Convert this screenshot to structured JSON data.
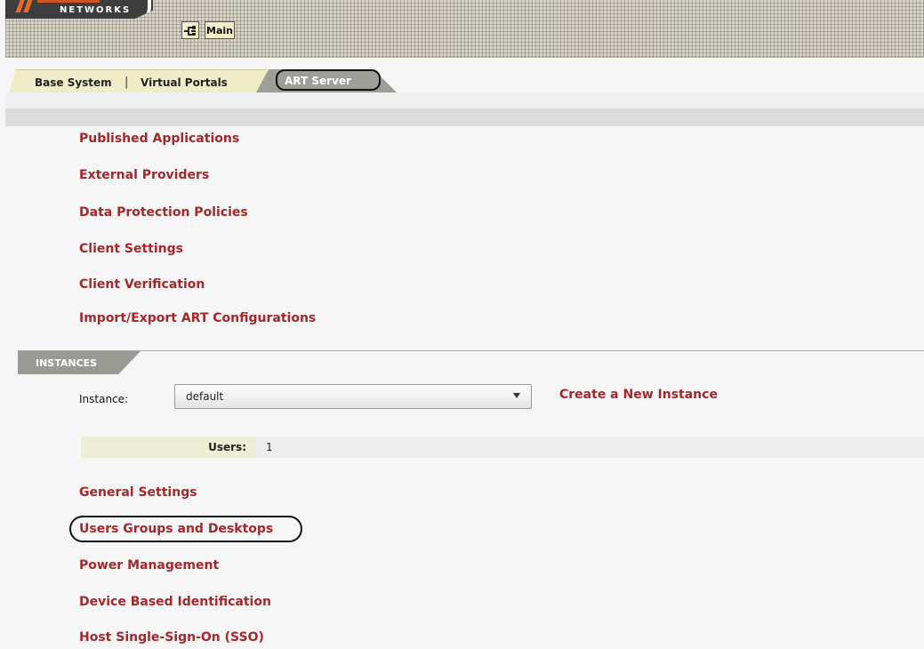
{
  "header": {
    "logo_text": "NETWORKS",
    "network_button_icon": "network-topology-icon",
    "main_button_label": "Main"
  },
  "tabs": [
    {
      "label": "Base System",
      "selected": false
    },
    {
      "label": "Virtual Portals",
      "selected": false
    },
    {
      "label": "ART Server",
      "selected": true
    }
  ],
  "tab_separator": "|",
  "art_links": [
    "Published Applications",
    "External Providers",
    "Data Protection Policies",
    "Client Settings",
    "Client Verification",
    "Import/Export ART Configurations"
  ],
  "instances": {
    "section_title": "INSTANCES",
    "instance_label": "Instance:",
    "selected_instance": "default",
    "create_link": "Create a New Instance",
    "users_label": "Users:",
    "users_count": "1"
  },
  "instance_links": [
    "General Settings",
    "Users Groups and Desktops",
    "Power Management",
    "Device Based Identification",
    "Host Single-Sign-On (SSO)"
  ],
  "colors": {
    "link": "#a3282c",
    "tab_selected": "#9e9e98",
    "tab_bg": "#f0ecc8",
    "logo_accent": "#e8682a"
  }
}
